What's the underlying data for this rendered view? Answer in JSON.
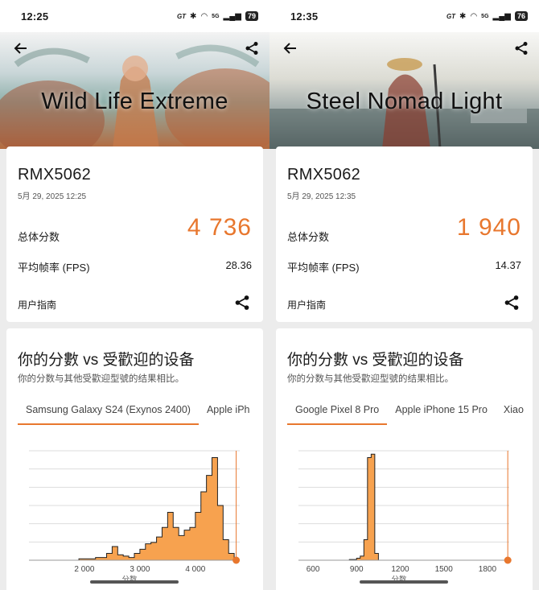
{
  "colors": {
    "accent": "#e8772e",
    "bar_fill": "#f7a24f",
    "bar_stroke": "#222222",
    "grid": "#dddddd"
  },
  "left": {
    "status": {
      "time": "12:25",
      "gt": "GT",
      "net": "5G",
      "battery": "79"
    },
    "hero": {
      "title": "Wild Life Extreme",
      "back_icon": "arrow-left-icon",
      "share_icon": "share-icon"
    },
    "result": {
      "device": "RMX5062",
      "date": "5月 29, 2025 12:25",
      "score_label": "总体分数",
      "score": "4 736",
      "fps_label": "平均帧率 (FPS)",
      "fps": "28.36",
      "guide_label": "用户指南"
    },
    "compare": {
      "title": "你的分數 vs 受歡迎的设备",
      "subtitle": "你的分数与其他受歡迎型號的结果相比。",
      "tabs": [
        "Samsung Galaxy S24 (Exynos 2400)",
        "Apple iPh"
      ],
      "active_tab": 0
    },
    "chart_data": {
      "type": "area",
      "xlabel": "分数",
      "x_ticks": [
        "2 000",
        "3 000",
        "4 000"
      ],
      "x_tick_values": [
        2000,
        3000,
        4000
      ],
      "xlim": [
        1000,
        4800
      ],
      "your_score": 4736,
      "x": [
        1000,
        1100,
        1200,
        1300,
        1400,
        1500,
        1600,
        1700,
        1800,
        1900,
        2000,
        2100,
        2200,
        2300,
        2400,
        2500,
        2600,
        2700,
        2800,
        2900,
        3000,
        3100,
        3200,
        3300,
        3400,
        3500,
        3600,
        3700,
        3800,
        3900,
        4000,
        4100,
        4200,
        4300,
        4400,
        4500,
        4600,
        4700
      ],
      "values": [
        0,
        0,
        0,
        0,
        0,
        0,
        0,
        0,
        0,
        1,
        1,
        1,
        2,
        2,
        5,
        10,
        4,
        3,
        2,
        5,
        8,
        12,
        13,
        17,
        24,
        35,
        24,
        18,
        22,
        24,
        35,
        50,
        62,
        75,
        40,
        15,
        5,
        0
      ],
      "ylim": [
        0,
        80
      ]
    }
  },
  "right": {
    "status": {
      "time": "12:35",
      "gt": "GT",
      "net": "5G",
      "battery": "76"
    },
    "hero": {
      "title": "Steel Nomad Light",
      "back_icon": "arrow-left-icon",
      "share_icon": "share-icon"
    },
    "result": {
      "device": "RMX5062",
      "date": "5月 29, 2025 12:35",
      "score_label": "总体分数",
      "score": "1 940",
      "fps_label": "平均帧率 (FPS)",
      "fps": "14.37",
      "guide_label": "用户指南"
    },
    "compare": {
      "title": "你的分數 vs 受歡迎的设备",
      "subtitle": "你的分数与其他受歡迎型號的结果相比。",
      "tabs": [
        "Google Pixel 8 Pro",
        "Apple iPhone 15 Pro",
        "Xiao"
      ],
      "active_tab": 0
    },
    "chart_data": {
      "type": "area",
      "xlabel": "分数",
      "x_ticks": [
        "600",
        "900",
        "1200",
        "1500",
        "1800"
      ],
      "x_tick_values": [
        600,
        900,
        1200,
        1500,
        1800
      ],
      "xlim": [
        500,
        1950
      ],
      "your_score": 1940,
      "x": [
        500,
        550,
        600,
        650,
        700,
        750,
        800,
        850,
        900,
        925,
        950,
        975,
        1000,
        1025,
        1050,
        1100,
        1150,
        1200,
        1250,
        1300,
        1350,
        1400,
        1450,
        1500,
        1550,
        1600,
        1650,
        1700,
        1750,
        1800,
        1850,
        1900
      ],
      "values": [
        0,
        0,
        0,
        0,
        0,
        0,
        0,
        1,
        3,
        6,
        30,
        150,
        155,
        10,
        0,
        0,
        0,
        0,
        0,
        0,
        0,
        0,
        0,
        0,
        0,
        0,
        0,
        0,
        0,
        0,
        0,
        0
      ],
      "ylim": [
        0,
        160
      ]
    }
  }
}
